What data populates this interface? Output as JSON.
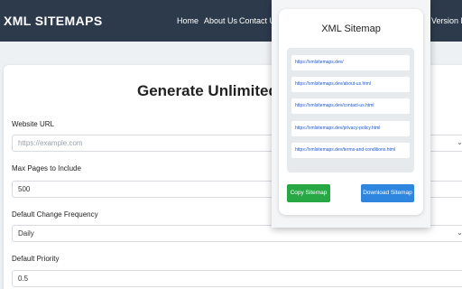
{
  "nav": {
    "brand": "XML SITEMAPS",
    "links": [
      "Home",
      "About Us",
      "Contact Us",
      "Version Hist"
    ]
  },
  "main": {
    "title": "Generate Unlimited Siter",
    "fields": [
      {
        "label": "Website URL",
        "placeholder": "https://example.com",
        "value": "",
        "type": "input"
      },
      {
        "label": "Max Pages to Include",
        "value": "500",
        "type": "input"
      },
      {
        "label": "Default Change Frequency",
        "value": "Daily",
        "type": "select"
      },
      {
        "label": "Default Priority",
        "value": "0.5",
        "type": "input"
      }
    ]
  },
  "popup": {
    "title": "XML Sitemap",
    "urls": [
      "https://xmlsitemaps.dev/",
      "https://xmlsitemaps.dev/about-us.html",
      "https://xmlsitemaps.dev/contact-us.html",
      "https://xmlsitemaps.dev/privacy-policy.html",
      "https://xmlsitemaps.dev/terms-and-conditions.html"
    ],
    "copy_label": "Copy Sitemap",
    "download_label": "Download Sitemap"
  },
  "icons": {
    "select_arrow": "chevron-down-icon"
  },
  "colors": {
    "navbar": "#2d3a4b",
    "copy_button": "#28a745",
    "download_button": "#2e86de",
    "link": "#1a57d6"
  }
}
